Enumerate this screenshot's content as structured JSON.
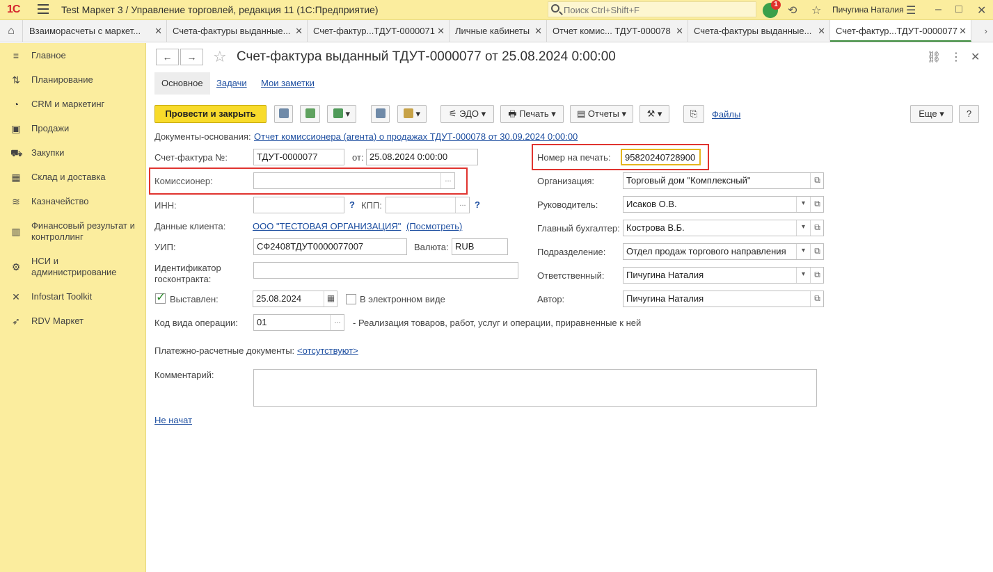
{
  "titlebar": {
    "logo": "1С",
    "app_title": "Test Маркет 3 / Управление торговлей, редакция 11  (1С:Предприятие)",
    "search_placeholder": "Поиск Ctrl+Shift+F",
    "notification_count": "1",
    "user_name": "Пичугина Наталия"
  },
  "tabs": [
    {
      "label": "Взаиморасчеты с маркет..."
    },
    {
      "label": "Счета-фактуры выданные..."
    },
    {
      "label": "Счет-фактур...ТДУТ-0000071"
    },
    {
      "label": "Личные кабинеты"
    },
    {
      "label": "Отчет комис... ТДУТ-000078"
    },
    {
      "label": "Счета-фактуры выданные..."
    },
    {
      "label": "Счет-фактур...ТДУТ-0000077"
    }
  ],
  "sidebar": {
    "items": [
      {
        "label": "Главное",
        "icon": "menu-lines-icon"
      },
      {
        "label": "Планирование",
        "icon": "planning-icon"
      },
      {
        "label": "CRM и маркетинг",
        "icon": "pie-chart-icon"
      },
      {
        "label": "Продажи",
        "icon": "shopping-bag-icon"
      },
      {
        "label": "Закупки",
        "icon": "cart-icon"
      },
      {
        "label": "Склад и доставка",
        "icon": "warehouse-icon"
      },
      {
        "label": "Казначейство",
        "icon": "coins-icon"
      },
      {
        "label": "Финансовый результат и контроллинг",
        "icon": "bar-chart-icon"
      },
      {
        "label": "НСИ и администрирование",
        "icon": "gear-icon"
      },
      {
        "label": "Infostart Toolkit",
        "icon": "tools-icon"
      },
      {
        "label": "RDV Маркет",
        "icon": "rocket-icon"
      }
    ]
  },
  "form": {
    "title": "Счет-фактура выданный ТДУТ-0000077 от 25.08.2024 0:00:00",
    "subtabs": {
      "main": "Основное",
      "tasks": "Задачи",
      "notes": "Мои заметки"
    },
    "toolbar": {
      "post_close": "Провести и закрыть",
      "edo": "ЭДО",
      "print": "Печать",
      "reports": "Отчеты",
      "files": "Файлы",
      "more": "Еще",
      "help": "?"
    },
    "fields": {
      "base_docs_label": "Документы-основания:",
      "base_docs_link": "Отчет комиссионера (агента) о продажах ТДУТ-000078 от 30.09.2024 0:00:00",
      "invoice_no_label": "Счет-фактура №:",
      "invoice_no": "ТДУТ-0000077",
      "from_label": "от:",
      "from_date": "25.08.2024  0:00:00",
      "print_no_label": "Номер на печать:",
      "print_no": "95820240728900",
      "commissioner_label": "Комиссионер:",
      "commissioner": "",
      "inn_label": "ИНН:",
      "kpp_label": "КПП:",
      "client_data_label": "Данные клиента:",
      "client_link": "ООО \"ТЕСТОВАЯ ОРГАНИЗАЦИЯ\"",
      "client_view": "(Посмотреть)",
      "uip_label": "УИП:",
      "uip": "СФ2408ТДУТ0000077007",
      "currency_label": "Валюта:",
      "currency": "RUB",
      "gov_contract_label": "Идентификатор госконтракта:",
      "issued_label": "Выставлен:",
      "issued_date": "25.08.2024",
      "electronic_label": "В электронном виде",
      "op_code_label": "Код вида операции:",
      "op_code": "01",
      "op_desc": "- Реализация товаров, работ, услуг и операции, приравненные к ней",
      "payment_docs_label": "Платежно-расчетные документы:",
      "payment_docs_link": "<отсутствуют>",
      "comment_label": "Комментарий:",
      "status_link": "Не начат",
      "org_label": "Организация:",
      "org": "Торговый дом \"Комплексный\"",
      "head_label": "Руководитель:",
      "head": "Исаков О.В.",
      "chief_acc_label": "Главный бухгалтер:",
      "chief_acc": "Кострова В.Б.",
      "dept_label": "Подразделение:",
      "dept": "Отдел продаж торгового направления",
      "responsible_label": "Ответственный:",
      "responsible": "Пичугина Наталия",
      "author_label": "Автор:",
      "author": "Пичугина Наталия"
    }
  }
}
